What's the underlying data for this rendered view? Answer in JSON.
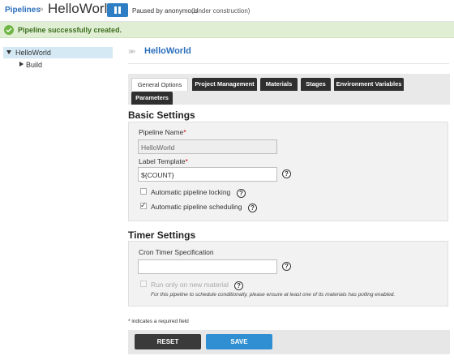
{
  "header": {
    "breadcrumb": "Pipelines",
    "breadcrumb_sep": "»",
    "pipeline_name": "HelloWorld",
    "paused_by": "Paused by anonymous",
    "status": "(Under construction)"
  },
  "flash": {
    "message": "Pipeline successfully created."
  },
  "tree": {
    "pipeline": "HelloWorld",
    "stage": "Build"
  },
  "page_header": {
    "arrows": "»»",
    "title": "HelloWorld"
  },
  "tabs": [
    {
      "label": "General Options",
      "active": true
    },
    {
      "label": "Project Management",
      "active": false
    },
    {
      "label": "Materials",
      "active": false
    },
    {
      "label": "Stages",
      "active": false
    },
    {
      "label": "Environment Variables",
      "active": false
    },
    {
      "label": "Parameters",
      "active": false
    }
  ],
  "basic": {
    "title": "Basic Settings",
    "pipeline_name_label": "Pipeline Name",
    "pipeline_name_value": "HelloWorld",
    "label_template_label": "Label Template",
    "label_template_value": "${COUNT}",
    "locking_label": "Automatic pipeline locking",
    "locking_checked": false,
    "scheduling_label": "Automatic pipeline scheduling",
    "scheduling_checked": true,
    "required_mark": "*",
    "help": "?"
  },
  "timer": {
    "title": "Timer Settings",
    "cron_label": "Cron Timer Specification",
    "cron_value": "",
    "only_new_label": "Run only on new material",
    "only_new_checked": false,
    "note": "For this pipeline to schedule conditionally, please ensure at least one of its materials has polling enabled."
  },
  "required_note": "* indicates a required field",
  "actions": {
    "reset": "RESET",
    "save": "SAVE"
  },
  "colors": {
    "accent": "#2d7ec4",
    "success_bg": "#e0efd4",
    "success_icon": "#6fb543",
    "tab_dark": "#2f2f2f",
    "save": "#2f8fd2",
    "reset": "#3a3a3a"
  }
}
